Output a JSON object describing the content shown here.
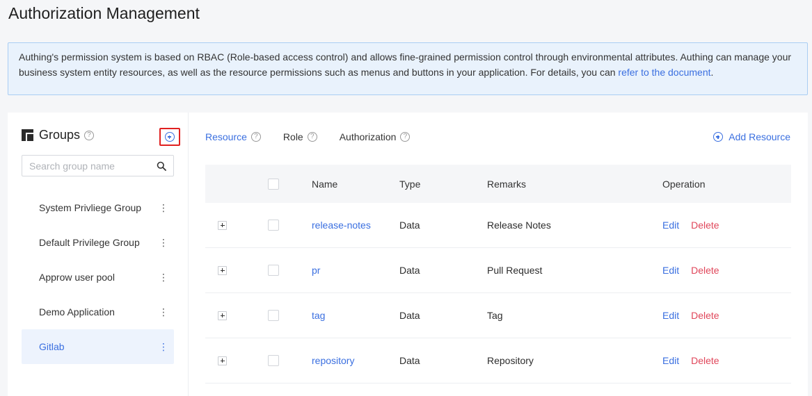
{
  "page": {
    "title": "Authorization Management"
  },
  "banner": {
    "text": "Authing's permission system is based on RBAC (Role-based access control) and allows fine-grained permission control through environmental attributes. Authing can manage your business system entity resources, as well as the resource permissions such as menus and buttons in your application. For details, you can ",
    "link_text": "refer to the document",
    "suffix": "."
  },
  "groups": {
    "title": "Groups",
    "search_placeholder": "Search group name",
    "items": [
      {
        "label": "System Privliege Group",
        "active": false
      },
      {
        "label": "Default Privilege Group",
        "active": false
      },
      {
        "label": "Approw user pool",
        "active": false
      },
      {
        "label": "Demo Application",
        "active": false
      },
      {
        "label": "Gitlab",
        "active": true
      }
    ]
  },
  "tabs": [
    {
      "label": "Resource",
      "active": true
    },
    {
      "label": "Role",
      "active": false
    },
    {
      "label": "Authorization",
      "active": false
    }
  ],
  "add_resource_label": "Add Resource",
  "table": {
    "columns": [
      "Name",
      "Type",
      "Remarks",
      "Operation"
    ],
    "rows": [
      {
        "name": "release-notes",
        "type": "Data",
        "remarks": "Release Notes"
      },
      {
        "name": "pr",
        "type": "Data",
        "remarks": "Pull Request"
      },
      {
        "name": "tag",
        "type": "Data",
        "remarks": "Tag"
      },
      {
        "name": "repository",
        "type": "Data",
        "remarks": "Repository"
      }
    ],
    "edit_label": "Edit",
    "delete_label": "Delete"
  },
  "icons": {
    "help": "question-circle-icon",
    "add": "plus-circle-icon",
    "search": "search-icon",
    "more": "vertical-ellipsis-icon",
    "groups": "folder-icon",
    "expand": "plus-square-icon"
  },
  "colors": {
    "accent": "#3a6fe0",
    "danger": "#e0465a",
    "highlight": "#e02020"
  }
}
